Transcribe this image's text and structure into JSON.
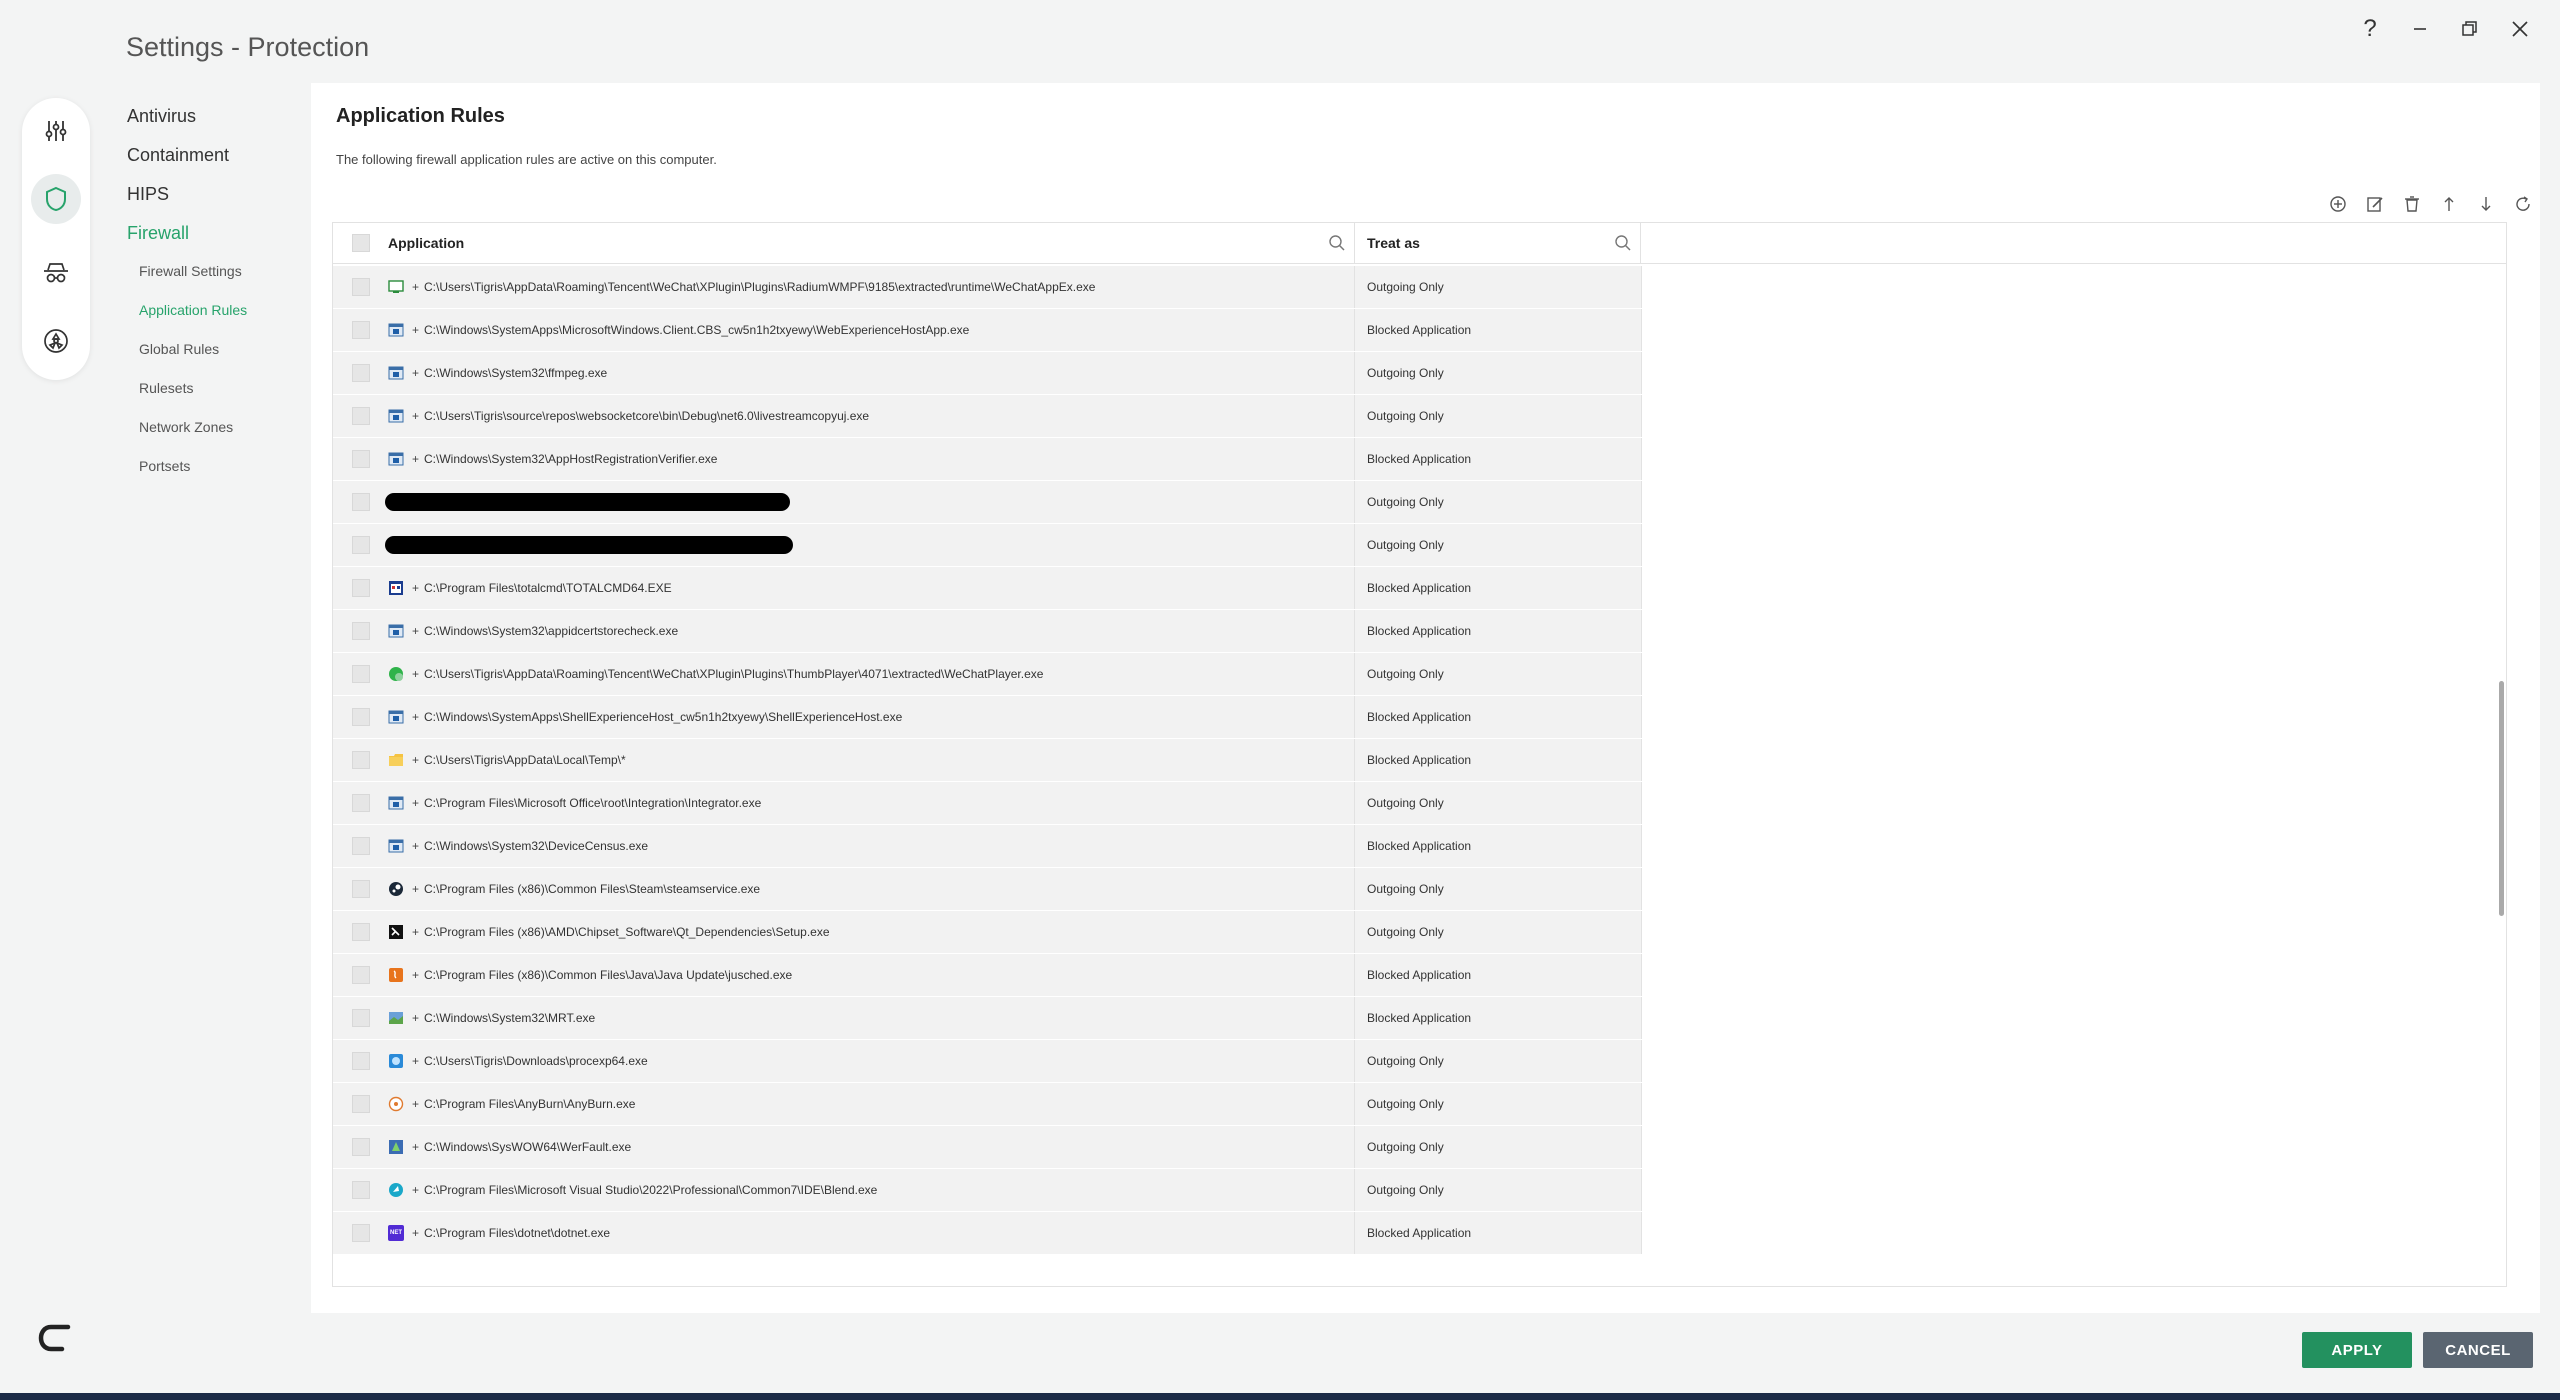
{
  "window": {
    "title": "Settings - Protection"
  },
  "nav": {
    "antivirus": "Antivirus",
    "containment": "Containment",
    "hips": "HIPS",
    "firewall": "Firewall",
    "firewall_settings": "Firewall Settings",
    "application_rules": "Application Rules",
    "global_rules": "Global Rules",
    "rulesets": "Rulesets",
    "network_zones": "Network Zones",
    "portsets": "Portsets"
  },
  "panel": {
    "title": "Application Rules",
    "description": "The following firewall application rules are active on this computer."
  },
  "table": {
    "col_application": "Application",
    "col_treat": "Treat as",
    "rows": [
      {
        "icon": "app-window-icon",
        "path": "C:\\Users\\Tigris\\AppData\\Roaming\\Tencent\\WeChat\\XPlugin\\Plugins\\RadiumWMPF\\9185\\extracted\\runtime\\WeChatAppEx.exe",
        "treat": "Outgoing Only"
      },
      {
        "icon": "exe-icon",
        "path": "C:\\Windows\\SystemApps\\MicrosoftWindows.Client.CBS_cw5n1h2txyewy\\WebExperienceHostApp.exe",
        "treat": "Blocked Application"
      },
      {
        "icon": "exe-icon",
        "path": "C:\\Windows\\System32\\ffmpeg.exe",
        "treat": "Outgoing Only"
      },
      {
        "icon": "exe-icon",
        "path": "C:\\Users\\Tigris\\source\\repos\\websocketcore\\bin\\Debug\\net6.0\\livestreamcopyuj.exe",
        "treat": "Outgoing Only"
      },
      {
        "icon": "exe-icon",
        "path": "C:\\Windows\\System32\\AppHostRegistrationVerifier.exe",
        "treat": "Blocked Application"
      },
      {
        "icon": "redacted",
        "path": "",
        "treat": "Outgoing Only"
      },
      {
        "icon": "redacted",
        "path": "",
        "treat": "Outgoing Only"
      },
      {
        "icon": "totalcmd-icon",
        "path": "C:\\Program Files\\totalcmd\\TOTALCMD64.EXE",
        "treat": "Blocked Application"
      },
      {
        "icon": "exe-icon",
        "path": "C:\\Windows\\System32\\appidcertstorecheck.exe",
        "treat": "Blocked Application"
      },
      {
        "icon": "wechat-player-icon",
        "path": "C:\\Users\\Tigris\\AppData\\Roaming\\Tencent\\WeChat\\XPlugin\\Plugins\\ThumbPlayer\\4071\\extracted\\WeChatPlayer.exe",
        "treat": "Outgoing Only"
      },
      {
        "icon": "exe-icon",
        "path": "C:\\Windows\\SystemApps\\ShellExperienceHost_cw5n1h2txyewy\\ShellExperienceHost.exe",
        "treat": "Blocked Application"
      },
      {
        "icon": "folder-icon",
        "path": "C:\\Users\\Tigris\\AppData\\Local\\Temp\\*",
        "treat": "Blocked Application"
      },
      {
        "icon": "exe-icon",
        "path": "C:\\Program Files\\Microsoft Office\\root\\Integration\\Integrator.exe",
        "treat": "Outgoing Only"
      },
      {
        "icon": "exe-icon",
        "path": "C:\\Windows\\System32\\DeviceCensus.exe",
        "treat": "Blocked Application"
      },
      {
        "icon": "steam-icon",
        "path": "C:\\Program Files (x86)\\Common Files\\Steam\\steamservice.exe",
        "treat": "Outgoing Only"
      },
      {
        "icon": "setup-icon",
        "path": "C:\\Program Files (x86)\\AMD\\Chipset_Software\\Qt_Dependencies\\Setup.exe",
        "treat": "Outgoing Only"
      },
      {
        "icon": "java-icon",
        "path": "C:\\Program Files (x86)\\Common Files\\Java\\Java Update\\jusched.exe",
        "treat": "Blocked Application"
      },
      {
        "icon": "mrt-icon",
        "path": "C:\\Windows\\System32\\MRT.exe",
        "treat": "Blocked Application"
      },
      {
        "icon": "procexp-icon",
        "path": "C:\\Users\\Tigris\\Downloads\\procexp64.exe",
        "treat": "Outgoing Only"
      },
      {
        "icon": "anyburn-icon",
        "path": "C:\\Program Files\\AnyBurn\\AnyBurn.exe",
        "treat": "Outgoing Only"
      },
      {
        "icon": "werfault-icon",
        "path": "C:\\Windows\\SysWOW64\\WerFault.exe",
        "treat": "Outgoing Only"
      },
      {
        "icon": "blend-icon",
        "path": "C:\\Program Files\\Microsoft Visual Studio\\2022\\Professional\\Common7\\IDE\\Blend.exe",
        "treat": "Outgoing Only"
      },
      {
        "icon": "dotnet-icon",
        "path": "C:\\Program Files\\dotnet\\dotnet.exe",
        "treat": "Blocked Application"
      }
    ]
  },
  "icon_labels": {
    "dotnet": "NET"
  },
  "buttons": {
    "apply": "APPLY",
    "cancel": "CANCEL"
  },
  "colors": {
    "accent": "#27a36b",
    "apply": "#23915f",
    "cancel": "#5a6571"
  }
}
